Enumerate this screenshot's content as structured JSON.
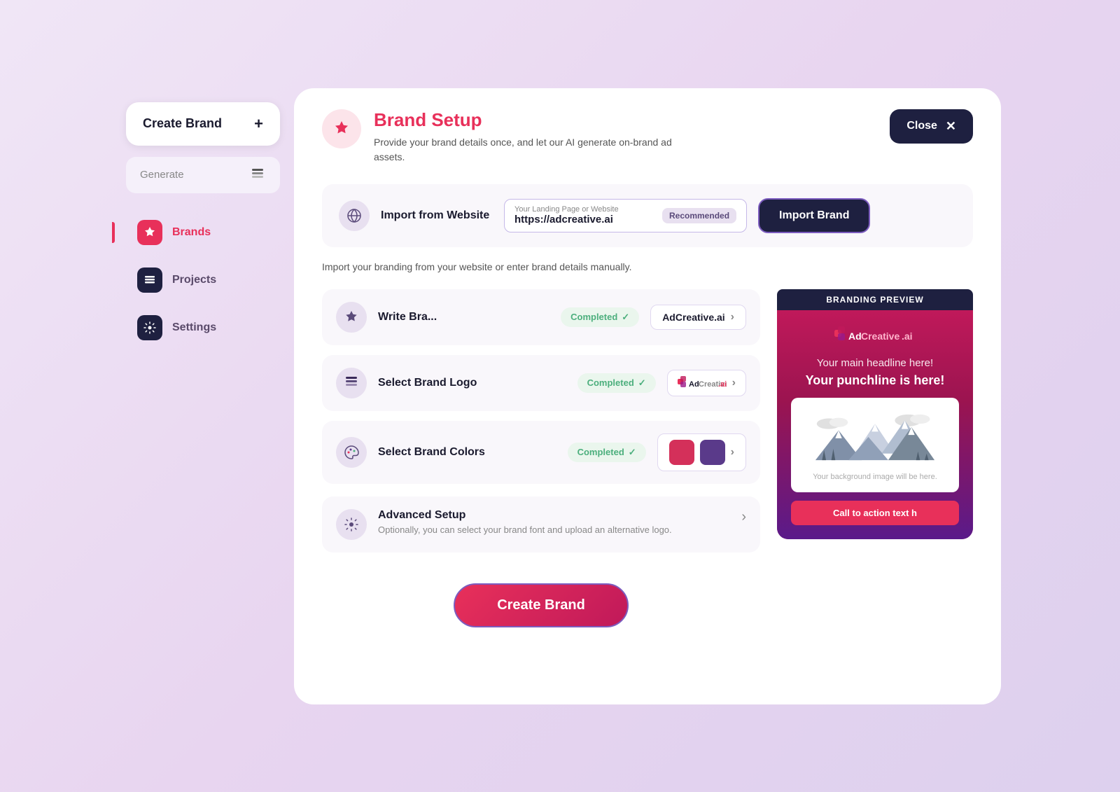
{
  "sidebar": {
    "create_brand_label": "Create Brand",
    "generate_label": "Generate",
    "nav_items": [
      {
        "id": "brands",
        "label": "Brands",
        "icon_type": "star",
        "active": true
      },
      {
        "id": "projects",
        "label": "Projects",
        "icon_type": "layers",
        "active": false
      },
      {
        "id": "settings",
        "label": "Settings",
        "icon_type": "gear",
        "active": false
      }
    ]
  },
  "header": {
    "icon": "star",
    "title": "Brand Setup",
    "subtitle": "Provide your brand details once, and let our AI generate on-brand ad assets.",
    "close_label": "Close"
  },
  "import_section": {
    "label": "Import from Website",
    "input_label": "Your Landing Page or Website",
    "input_value": "https://adcreative.ai",
    "recommended_badge": "Recommended",
    "button_label": "Import Brand"
  },
  "import_note": "Import your branding from your website or enter brand details manually.",
  "steps": [
    {
      "id": "write-brand",
      "icon": "star",
      "title": "Write Bra...",
      "status": "Completed",
      "value": "AdCreative.ai"
    },
    {
      "id": "select-logo",
      "icon": "layers",
      "title": "Select Brand Logo",
      "status": "Completed",
      "value": "AdCreative.ai"
    },
    {
      "id": "select-colors",
      "icon": "paint",
      "title": "Select Brand Colors",
      "status": "Completed",
      "colors": [
        "#d4305a",
        "#5a3a8a"
      ]
    }
  ],
  "advanced_setup": {
    "title": "Advanced Setup",
    "subtitle": "Optionally, you can select your brand font and upload an alternative logo."
  },
  "preview": {
    "label": "BRANDING PREVIEW",
    "logo_text_1": "Ad",
    "logo_text_2": "Creative",
    "logo_text_3": ".ai",
    "headline": "Your main headline here!",
    "punchline": "Your punchline is here!",
    "bg_image_text": "Your background image will be here.",
    "cta_text": "Call to action text h"
  },
  "footer": {
    "create_brand_label": "Create Brand"
  }
}
